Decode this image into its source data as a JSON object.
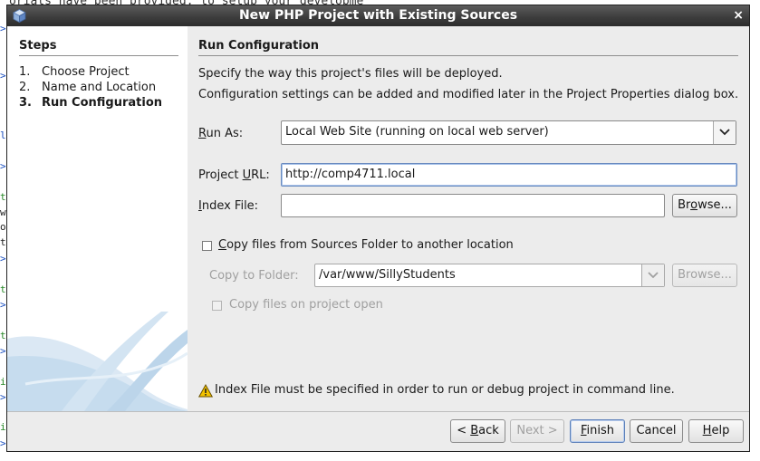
{
  "background": {
    "top_text": "orials have been provided, to setup your developme",
    "gutter": [
      ">",
      ">",
      "l",
      ">",
      "t",
      "w",
      "o",
      "t",
      ">",
      "t",
      ">",
      "t",
      ">",
      "i",
      ">",
      "i",
      ">"
    ]
  },
  "dialog": {
    "title": "New PHP Project with Existing Sources",
    "close_glyph": "×"
  },
  "steps": {
    "heading": "Steps",
    "items": [
      {
        "num": "1.",
        "label": "Choose Project"
      },
      {
        "num": "2.",
        "label": "Name and Location"
      },
      {
        "num": "3.",
        "label": "Run Configuration"
      }
    ]
  },
  "content": {
    "title": "Run Configuration",
    "desc1": "Specify the way this project's files will be deployed.",
    "desc2": "Configuration settings can be added and modified later in the Project Properties dialog box.",
    "run_as": {
      "label_u": "R",
      "label_rest": "un As:",
      "value": "Local Web Site (running on local web server)"
    },
    "project_url": {
      "label_pre": "Project ",
      "label_u": "U",
      "label_rest": "RL:",
      "value": "http://comp4711.local"
    },
    "index_file": {
      "label_u": "I",
      "label_rest": "ndex File:",
      "value": "",
      "browse_pre": "Br",
      "browse_u": "o",
      "browse_rest": "wse..."
    },
    "copy_files": {
      "label_u": "C",
      "label_rest": "opy files from Sources Folder to another location",
      "checked": false
    },
    "copy_to": {
      "label": "Copy to Folder:",
      "value": "/var/www/SillyStudents",
      "browse": "Browse..."
    },
    "copy_on_open": {
      "label": "Copy files on project open",
      "checked": false
    },
    "warning": "Index File must be specified in order to run or debug project in command line."
  },
  "buttons": {
    "back_pre": "< ",
    "back_u": "B",
    "back_rest": "ack",
    "next": "Next >",
    "finish_u": "F",
    "finish_rest": "inish",
    "cancel": "Cancel",
    "help_u": "H",
    "help_rest": "elp"
  },
  "colors": {
    "accent": "#5b7fb8",
    "warning": "#f2c200"
  }
}
